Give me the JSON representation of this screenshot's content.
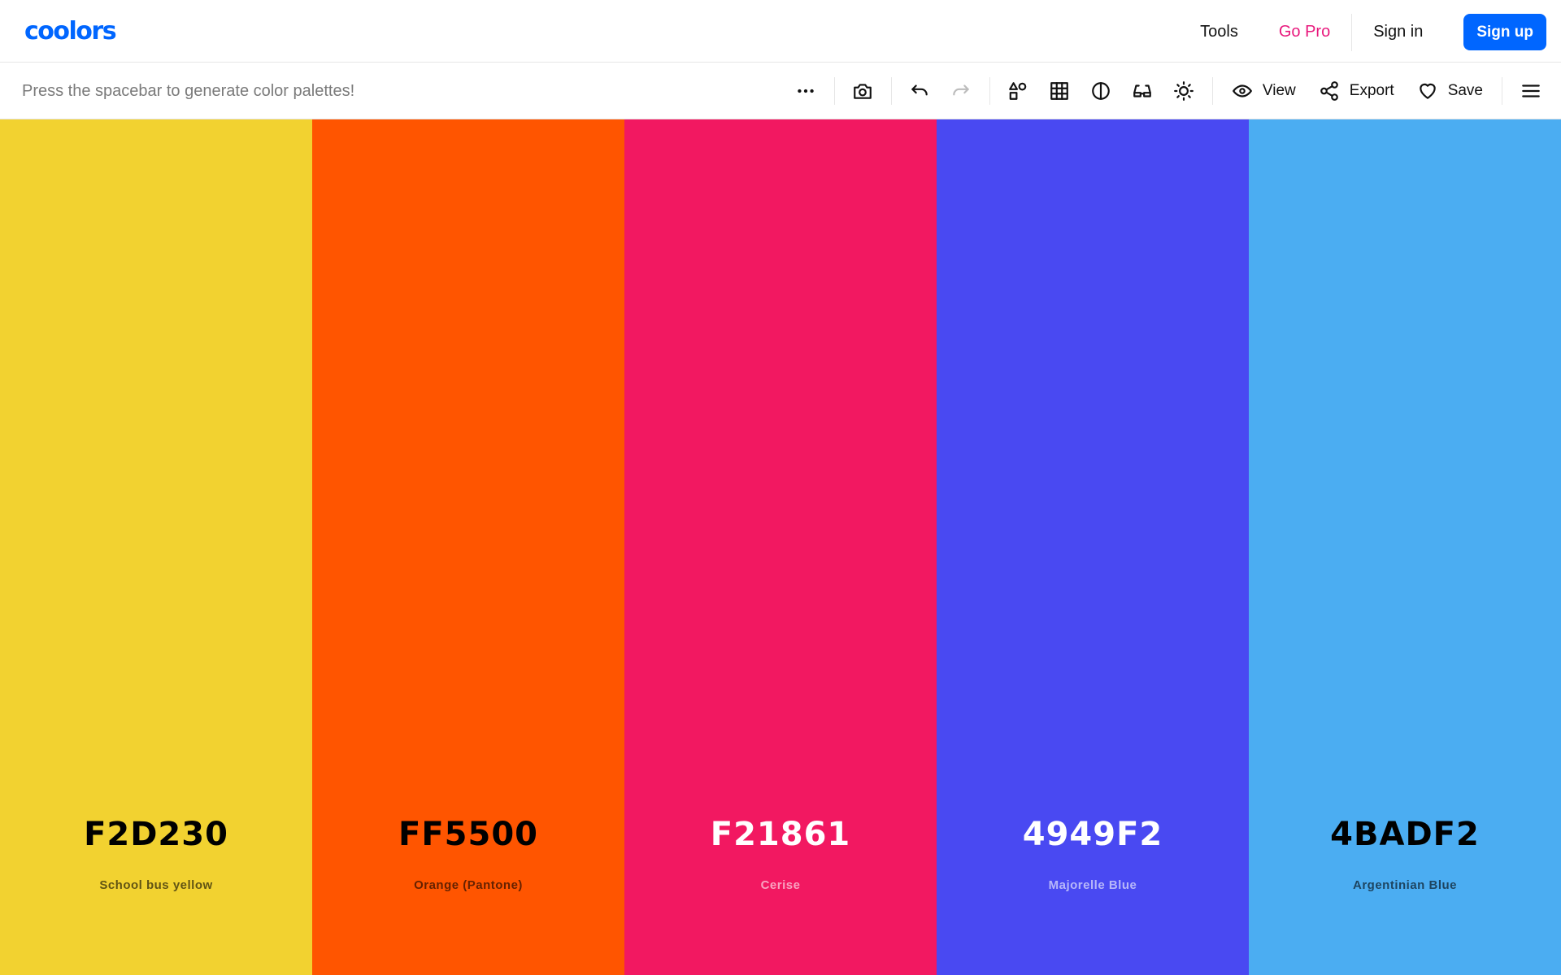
{
  "app": {
    "logo_text": "coolors",
    "brand_color": "#0066ff",
    "pro_color": "#e8197d"
  },
  "nav": {
    "tools": "Tools",
    "go_pro": "Go Pro",
    "sign_in": "Sign in",
    "sign_up": "Sign up"
  },
  "toolbar": {
    "hint": "Press the spacebar to generate color palettes!",
    "icons": [
      "more-options-icon",
      "camera-icon",
      "undo-icon",
      "redo-icon",
      "shapes-icon",
      "grid-icon",
      "contrast-icon",
      "glasses-icon",
      "sun-icon",
      "eye-icon",
      "share-icon",
      "heart-icon",
      "hamburger-menu-icon"
    ],
    "view_label": "View",
    "export_label": "Export",
    "save_label": "Save"
  },
  "palette": [
    {
      "hex": "F2D230",
      "name": "School bus yellow",
      "bg": "#F2D230",
      "text_color": "#000000"
    },
    {
      "hex": "FF5500",
      "name": "Orange (Pantone)",
      "bg": "#FF5500",
      "text_color": "#000000"
    },
    {
      "hex": "F21861",
      "name": "Cerise",
      "bg": "#F21861",
      "text_color": "#ffffff"
    },
    {
      "hex": "4949F2",
      "name": "Majorelle Blue",
      "bg": "#4949F2",
      "text_color": "#ffffff"
    },
    {
      "hex": "4BADF2",
      "name": "Argentinian Blue",
      "bg": "#4BADF2",
      "text_color": "#000000"
    }
  ]
}
